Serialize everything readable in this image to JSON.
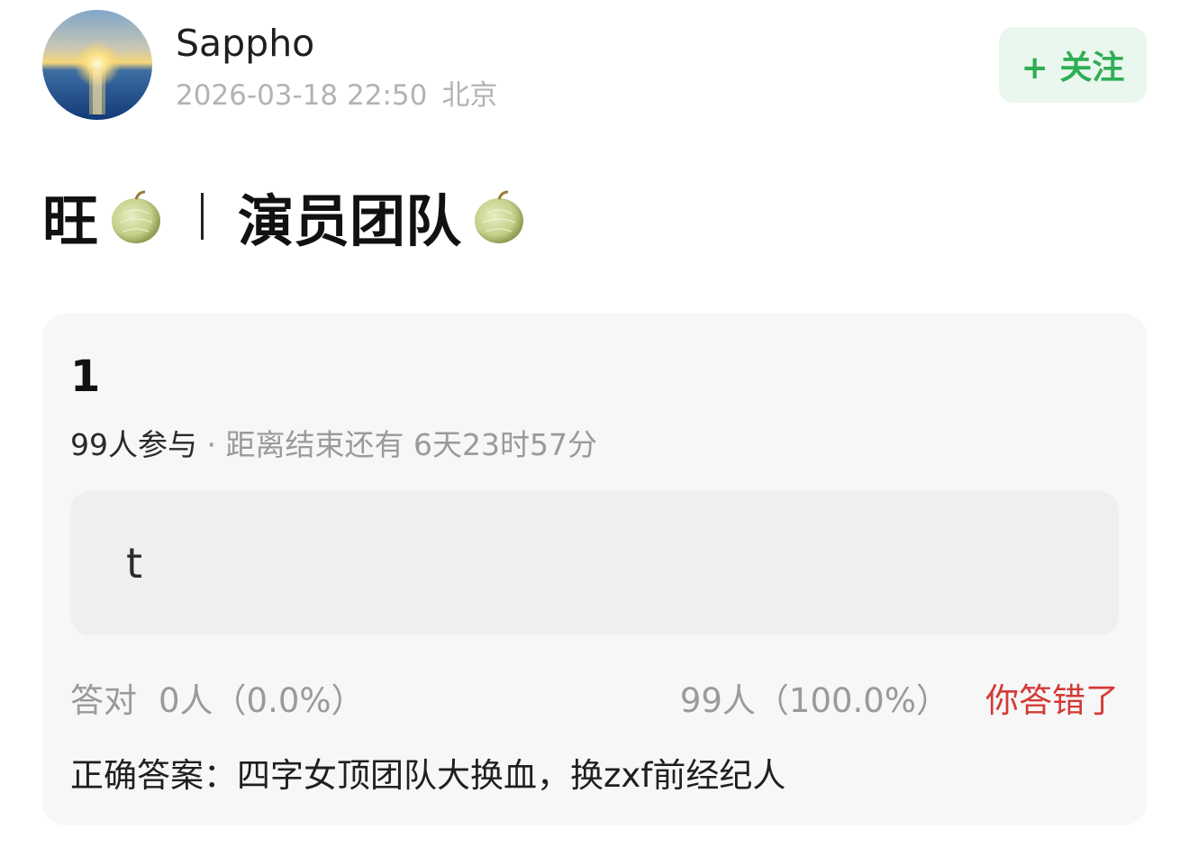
{
  "header": {
    "username": "Sappho",
    "date": "2026-03-18 22:50",
    "location": "北京",
    "follow_label": "+ 关注"
  },
  "title": {
    "part1": "旺",
    "part2": "演员团队",
    "emoji": "melon"
  },
  "quiz": {
    "number": "1",
    "participants": "99人参与",
    "separator": " · ",
    "time_left": "距离结束还有 6天23时57分",
    "option_text": "t",
    "correct_label": "答对",
    "correct_stat": "0人（0.0%）",
    "wrong_stat": "99人（100.0%）",
    "result_label": "你答错了",
    "answer": "正确答案：四字女顶团队大换血，换zxf前经纪人"
  },
  "colors": {
    "follow_text": "#2fae55",
    "follow_bg": "#eaf7ee",
    "wrong": "#d33a35",
    "muted": "#9a9a9a"
  }
}
